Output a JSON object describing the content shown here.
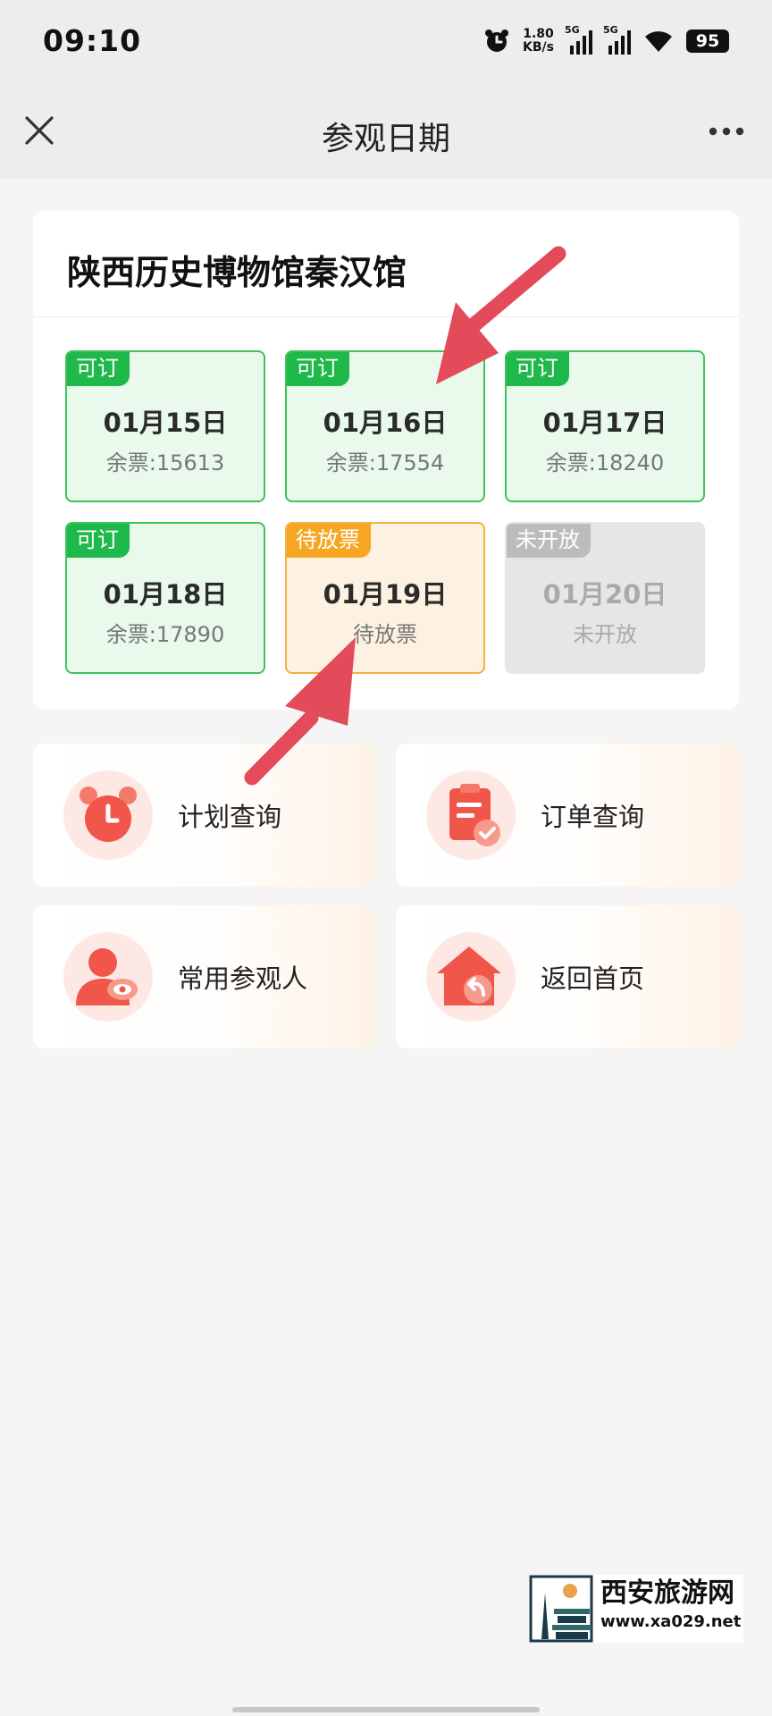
{
  "status_bar": {
    "time": "09:10",
    "net_speed_value": "1.80",
    "net_speed_unit": "KB/s",
    "signal1_label": "5G",
    "signal2_label": "5G",
    "battery": "95"
  },
  "nav": {
    "title": "参观日期",
    "close_icon": "close-icon",
    "more_icon": "more-icon"
  },
  "venue": {
    "name": "陕西历史博物馆秦汉馆",
    "days": [
      {
        "tag": "可订",
        "date": "01月15日",
        "remaining": "余票:15613",
        "status": "available"
      },
      {
        "tag": "可订",
        "date": "01月16日",
        "remaining": "余票:17554",
        "status": "available"
      },
      {
        "tag": "可订",
        "date": "01月17日",
        "remaining": "余票:18240",
        "status": "available"
      },
      {
        "tag": "可订",
        "date": "01月18日",
        "remaining": "余票:17890",
        "status": "available"
      },
      {
        "tag": "待放票",
        "date": "01月19日",
        "remaining": "待放票",
        "status": "pending"
      },
      {
        "tag": "未开放",
        "date": "01月20日",
        "remaining": "未开放",
        "status": "closed"
      }
    ]
  },
  "actions": [
    {
      "label": "计划查询",
      "icon": "alarm-clock-icon"
    },
    {
      "label": "订单查询",
      "icon": "clipboard-check-icon"
    },
    {
      "label": "常用参观人",
      "icon": "person-eye-icon"
    },
    {
      "label": "返回首页",
      "icon": "home-return-icon"
    }
  ],
  "watermark": {
    "name": "西安旅游网",
    "url": "www.xa029.net"
  },
  "colors": {
    "available": "#1fb84a",
    "pending": "#f6a623",
    "closed": "#bcbcbc",
    "accent": "#f0564a",
    "arrow": "#e34a5a"
  }
}
